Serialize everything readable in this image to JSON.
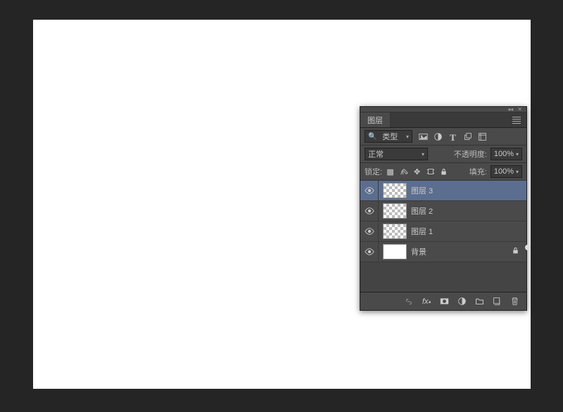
{
  "panel": {
    "tab_label": "图层",
    "filter_label": "类型",
    "blend_mode": "正常",
    "opacity_label": "不透明度:",
    "opacity_value": "100%",
    "lock_label": "锁定:",
    "fill_label": "填充:",
    "fill_value": "100%"
  },
  "layers": [
    {
      "name": "图层 3",
      "transparent": true,
      "locked": false,
      "active": true
    },
    {
      "name": "图层 2",
      "transparent": true,
      "locked": false,
      "active": false
    },
    {
      "name": "图层 1",
      "transparent": true,
      "locked": false,
      "active": false
    },
    {
      "name": "背景",
      "transparent": false,
      "locked": true,
      "active": false
    }
  ]
}
